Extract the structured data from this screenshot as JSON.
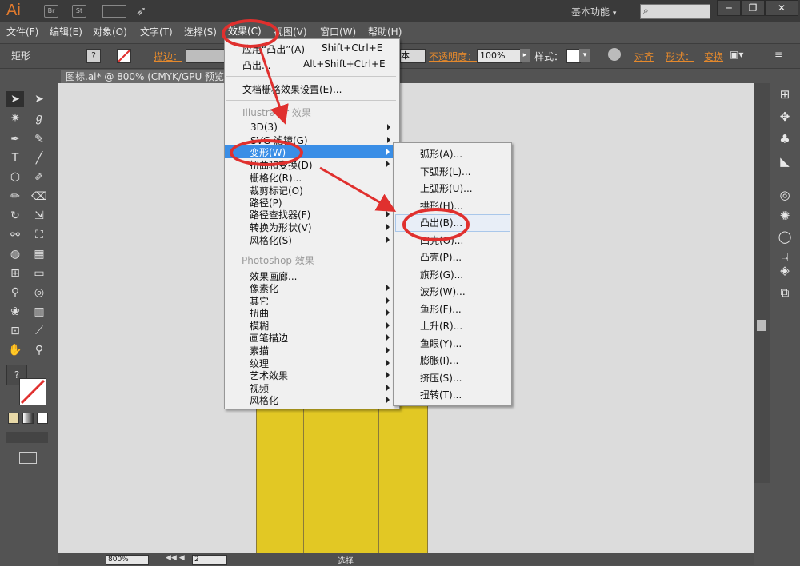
{
  "app": {
    "logo": "Ai",
    "workspace": "基本功能",
    "search_placeholder": ""
  },
  "titlebar_icons": [
    "Br",
    "St"
  ],
  "window_controls": [
    "─",
    "❐",
    "✕"
  ],
  "menubar": [
    "文件(F)",
    "编辑(E)",
    "对象(O)",
    "文字(T)",
    "选择(S)",
    "效果(C)",
    "视图(V)",
    "窗口(W)",
    "帮助(H)"
  ],
  "controlbar": {
    "object_type": "矩形",
    "stroke_label": "描边：",
    "basic_label": "本",
    "opacity_label": "不透明度：",
    "opacity_value": "100%",
    "style_label": "样式：",
    "align_label": "对齐",
    "shape_label": "形状：",
    "transform_label": "变换"
  },
  "document_tab": "图标.ai* @ 800% (CMYK/GPU 预览)",
  "effect_menu": {
    "apply_label": "应用“凸出”(A)",
    "apply_shortcut": "Shift+Ctrl+E",
    "bulge_label": "凸出...",
    "bulge_shortcut": "Alt+Shift+Ctrl+E",
    "raster_settings": "文档栅格效果设置(E)...",
    "illustrator_header": "Illustrator 效果",
    "illustrator_items": [
      "3D(3)",
      "SVG 滤镜(G)",
      "变形(W)",
      "扭曲和变换(D)",
      "栅格化(R)...",
      "裁剪标记(O)",
      "路径(P)",
      "路径查找器(F)",
      "转换为形状(V)",
      "风格化(S)"
    ],
    "photoshop_header": "Photoshop 效果",
    "photoshop_items": [
      "效果画廊...",
      "像素化",
      "其它",
      "扭曲",
      "模糊",
      "画笔描边",
      "素描",
      "纹理",
      "艺术效果",
      "视频",
      "风格化"
    ]
  },
  "warp_submenu": [
    "弧形(A)...",
    "下弧形(L)...",
    "上弧形(U)...",
    "拱形(H)...",
    "凸出(B)...",
    "凹壳(O)...",
    "凸壳(P)...",
    "旗形(G)...",
    "波形(W)...",
    "鱼形(F)...",
    "上升(R)...",
    "鱼眼(Y)...",
    "膨胀(I)...",
    "挤压(S)...",
    "扭转(T)..."
  ],
  "statusbar": {
    "zoom": "800%",
    "page": "2",
    "mode": "选择"
  },
  "colors": {
    "accent_red": "#e0302e",
    "highlight": "#3a8ee6",
    "shape_yellow": "#e2c824"
  }
}
